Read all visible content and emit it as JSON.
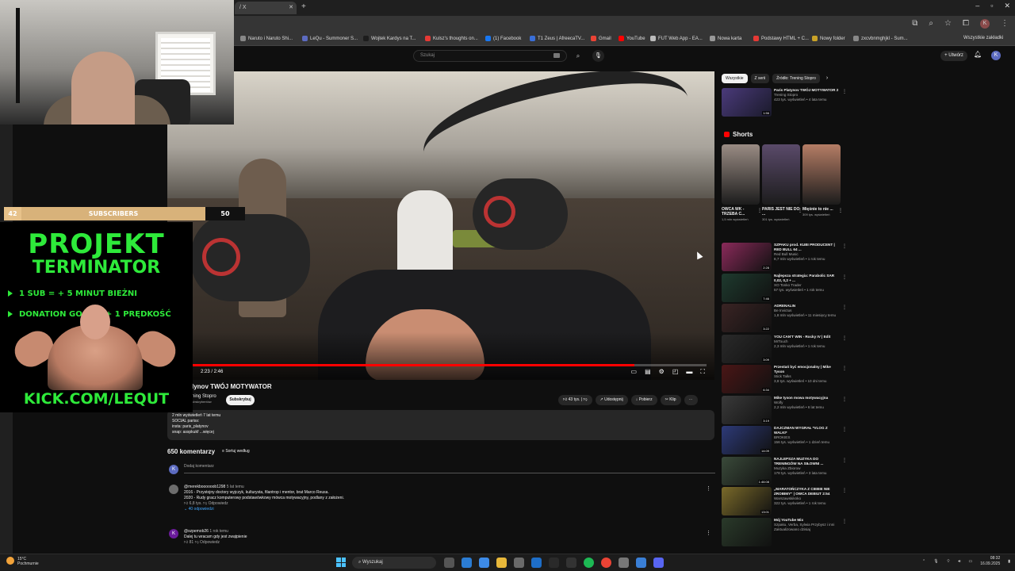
{
  "browser": {
    "tab_title": "/ X",
    "bookmarks": [
      {
        "label": "Naruto i Naruto Shi...",
        "color": "#888888"
      },
      {
        "label": "LeQu - Summoner S...",
        "color": "#5c6bc0"
      },
      {
        "label": "Wojtek Kardys na T...",
        "color": "#1d1d1d"
      },
      {
        "label": "Kulsz's thoughts on...",
        "color": "#e53935"
      },
      {
        "label": "(1) Facebook",
        "color": "#1877f2"
      },
      {
        "label": "T1 Zeus | AfreecaTV...",
        "color": "#3a6fd8"
      },
      {
        "label": "Gmail",
        "color": "#ea4335"
      },
      {
        "label": "YouTube",
        "color": "#ff0000"
      },
      {
        "label": "FUT Web App - EA...",
        "color": "#bbbbbb"
      },
      {
        "label": "Nowa karta",
        "color": "#999999"
      },
      {
        "label": "Podstawy HTML + C...",
        "color": "#e53935"
      },
      {
        "label": "Nowy folder",
        "color": "#c9a227"
      },
      {
        "label": "zxcvbnmghjkl - Sum...",
        "color": "#888888"
      }
    ],
    "all_bookmarks": "Wszystkie zakładki"
  },
  "youtube": {
    "search_placeholder": "Szukaj",
    "create_label": "Utwórz",
    "user_initial": "K"
  },
  "video": {
    "title": "lynov TWÓJ MOTYWATOR",
    "channel": "ning Stopro",
    "subscribers": "ubskrybentów",
    "subscribe_label": "Subskrybuj",
    "time": "2:23 / 2:46",
    "progress_fraction": 0.86,
    "likes": "43 tys.",
    "share_label": "Udostępnij",
    "download_label": "Pobierz",
    "clip_label": "Klip",
    "description": {
      "stats": "2 mln wyświetleń  7 lat temu",
      "line1": "SOCIAL pariss:",
      "line2": "insta: paris_platynov",
      "line3": "snap: asspkukf ...więcej"
    }
  },
  "comments": {
    "count_label": "650 komentarzy",
    "sort_label": "Sortuj według",
    "add_label": "Dodaj komentarz",
    "self_initial": "K",
    "items": [
      {
        "avatar": "",
        "user": "@merekboooooob1298",
        "ago": "5 lat temu",
        "text1": "2016 - Przystojny doctory wyjczyk, kulturysta, filantrop i mentor, brat Marco Reusa.",
        "text2": "2020 - Rudy gracz komputerowy podstawówkowy mówca motywacyjny, podlany z założeni.",
        "likes": "6,8 tys.",
        "reply_label": "Odpowiedz",
        "replies_label": "40 odpowiedzi"
      },
      {
        "avatar": "K",
        "user": "@szpemob26",
        "ago": "1 rok temu",
        "text1": "Dalej tu wracam gdy jest zwątpienie",
        "text2": "",
        "likes": "81",
        "reply_label": "Odpowiedz",
        "replies_label": ""
      }
    ]
  },
  "sidebar": {
    "chips": [
      "Wszystkie",
      "Z serii",
      "Źródło: Trening Stopro"
    ],
    "shorts_title": "Shorts",
    "top_video": {
      "title": "Paris Platynov TWÓJ MOTYWATOR 2",
      "channel": "Trening Stopro",
      "stats": "423 tys. wyświetleń • 4 lata temu",
      "duration": "1:56"
    },
    "shorts": [
      {
        "title": "OWCA WK - TRZEBA C...",
        "views": "1,5 mln wyświetleń",
        "color": "#9a8c84"
      },
      {
        "title": "PARIS JEST NIE DO ...",
        "views": "301 tys. wyświetleń",
        "color": "#5a4a6a"
      },
      {
        "title": "Mięśnie to nie ...",
        "views": "309 tys. wyświetleń",
        "color": "#b57d65"
      }
    ],
    "videos": [
      {
        "title": "SZPAKU prod. KUBI PRODUCENT | RED BULL 64 ...",
        "channel": "Red Bull Music",
        "stats": "8,7 mln wyświetleń • 1 rok temu",
        "duration": "2:28",
        "color": "#8a2a5a"
      },
      {
        "title": "Najlepsza strategia: Parabolic SAR 0,02, 0,2 + ...",
        "channel": "XO Tonko Trader",
        "stats": "57 tys. wyświetleń • 1 rok temu",
        "duration": "7:46",
        "color": "#1e3a2e"
      },
      {
        "title": "ADRENALIN",
        "channel": "Be Invictus",
        "stats": "1,8 mln wyświetleń • 11 miesięcy temu",
        "duration": "3:22",
        "color": "#3a2424"
      },
      {
        "title": "YOU CAN'T WIN - Rocky IV | Edit",
        "channel": "MrTouch",
        "stats": "2,3 mln wyświetleń • 1 rok temu",
        "duration": "3:09",
        "color": "#2a2a2a"
      },
      {
        "title": "Przestań być emocjonalny | Mike Tyson",
        "channel": "Stick Talks",
        "stats": "3,8 tys. wyświetleń • 10 dni temu",
        "duration": "6:34",
        "color": "#4a1616"
      },
      {
        "title": "Mike tyson mowa motywacyjna",
        "channel": "Wolfy",
        "stats": "2,2 mln wyświetleń • 6 lat temu",
        "duration": "3:19",
        "color": "#3a3a3a"
      },
      {
        "title": "DAJCZMAN WYGRAŁ *VLOG Z WALKI*",
        "channel": "BROKIES",
        "stats": "156 tys. wyświetleń • 1 dzień temu",
        "duration": "14:09",
        "color": "#2d3a78"
      },
      {
        "title": "NAJLEPSZA MUZYKA DO TRENINGÓW NA SIŁOWNI ...",
        "channel": "Muzyka Zbiorow",
        "stats": "178 tys. wyświetleń • 3 lata temu",
        "duration": "1:46:08",
        "color": "#3a4a3a"
      },
      {
        "title": "„MARATOŃCZYKA Z CIEBIE NIE ZROBIMY\" | OWCA DEBIUT 2:54",
        "channel": "Warszawskiknko",
        "stats": "322 tys. wyświetleń • 1 rok temu",
        "duration": "13:01",
        "color": "#7a6a2a"
      },
      {
        "title": "Mój YouTube Mix",
        "channel": "Szpaku, Verba, Sylwia Przybysz i inni",
        "stats": "Zaktualizowano dzisiaj",
        "duration": "",
        "color": "#2a3a2a"
      }
    ]
  },
  "stream_overlay": {
    "sub_current": "42",
    "sub_label": "SUBSCRIBERS",
    "sub_goal": "50",
    "title1": "PROJEKT",
    "title2": "TERMINATOR",
    "rule1": "1 SUB = + 5 MINUT BIEŻNI",
    "rule2": "DONATION GOAL = + 1 PRĘDKOŚĆ",
    "url": "KICK.COM/LEQUT",
    "accent": "#2eea3a"
  },
  "taskbar": {
    "temp": "15°C",
    "weather": "Pochmurnie",
    "search": "Wyszukaj",
    "time": "08:32",
    "date": "16.09.2025"
  }
}
